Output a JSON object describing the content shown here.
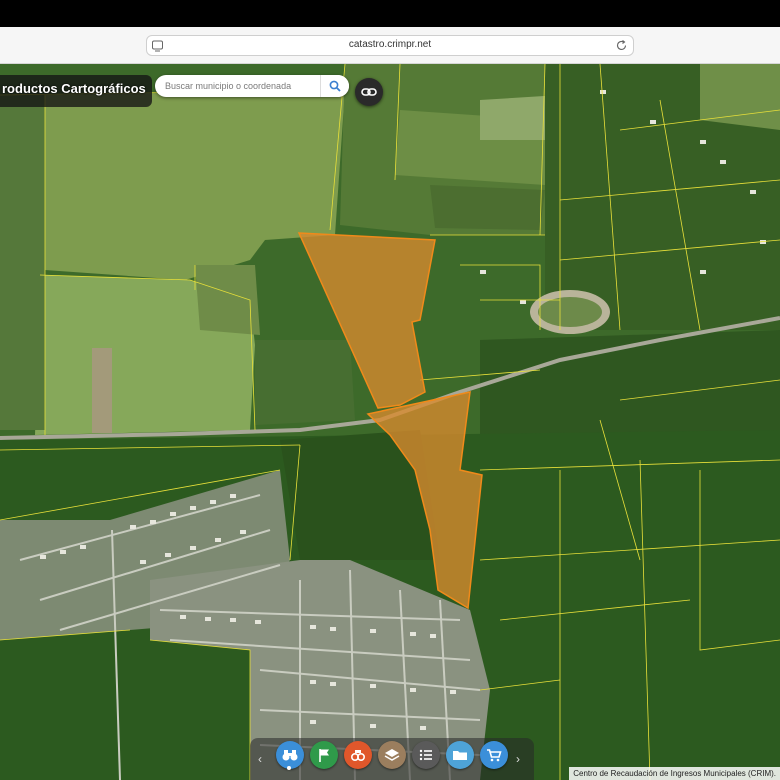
{
  "browser": {
    "url": "catastro.crimpr.net"
  },
  "app": {
    "title": "roductos Cartográficos",
    "search_placeholder": "Buscar municipio o coordenada"
  },
  "toolbar": {
    "tools": [
      {
        "name": "binoculars-icon",
        "color": "#3b8fd9"
      },
      {
        "name": "flag-icon",
        "color": "#2f9a4a"
      },
      {
        "name": "tools-icon",
        "color": "#e0572b"
      },
      {
        "name": "layers-icon",
        "color": "#9b7e5e"
      },
      {
        "name": "list-icon",
        "color": "#5a5a5a"
      },
      {
        "name": "folder-icon",
        "color": "#4ea3d8"
      },
      {
        "name": "cart-icon",
        "color": "#3b8fd9"
      }
    ]
  },
  "footer": {
    "credit": "Centro de Recaudación de Ingresos Municipales (CRIM)."
  },
  "colors": {
    "parcel_line": "#e8e03a",
    "selected_fill": "#d98a2e",
    "selected_stroke": "#f08a1a",
    "road": "#9a9a8a"
  }
}
